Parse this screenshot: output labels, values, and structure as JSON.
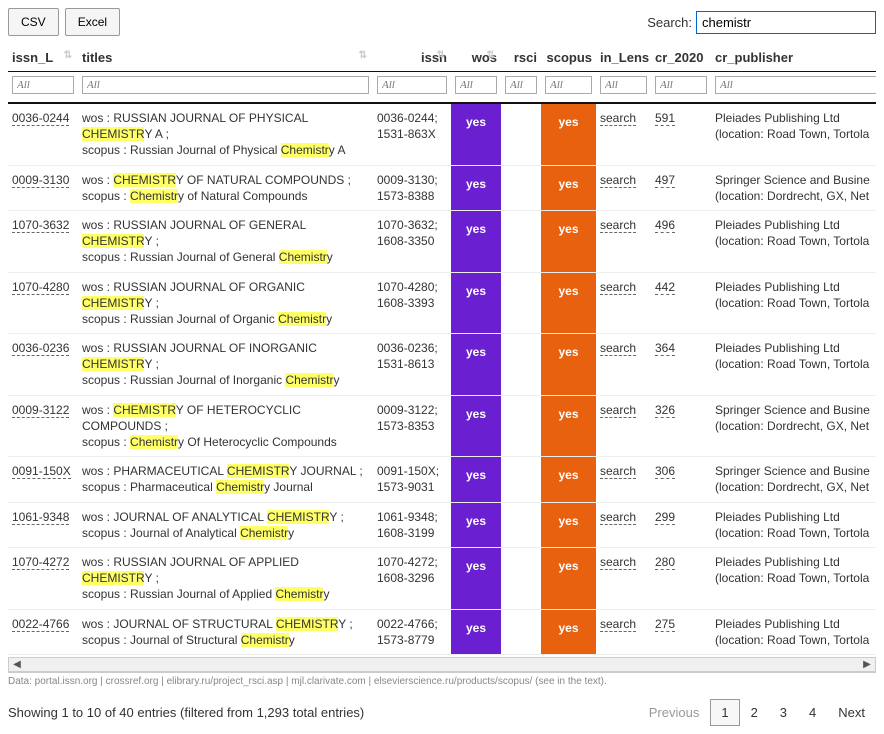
{
  "buttons": {
    "csv": "CSV",
    "excel": "Excel"
  },
  "search": {
    "label": "Search:",
    "value": "chemistr"
  },
  "headers": [
    "issn_L",
    "titles",
    "issn",
    "wos",
    "rsci",
    "scopus",
    "in_Lens",
    "cr_2020",
    "cr_publisher"
  ],
  "filter_ph": "All",
  "hlFull": "CHEMISTR",
  "hlLow": "Chemistr",
  "yes": "yes",
  "searchTxt": "search",
  "rows": [
    {
      "issn_l": "0036-0244",
      "t1a": "wos : RUSSIAN JOURNAL OF PHYSICAL ",
      "t1b": "Y A ;",
      "t2a": "scopus : Russian Journal of Physical ",
      "t2b": "y A",
      "issn": "0036-0244; 1531-863X",
      "cr": "591",
      "pub": "Pleiades Publishing Ltd",
      "loc": "(location: Road Town, Tortola"
    },
    {
      "issn_l": "0009-3130",
      "t1a": "wos : ",
      "t1b": "Y OF NATURAL COMPOUNDS ;",
      "t2a": "scopus : ",
      "t2b": "y of Natural Compounds",
      "issn": "0009-3130; 1573-8388",
      "cr": "497",
      "pub": "Springer Science and Busine",
      "loc": "(location: Dordrecht, GX, Net"
    },
    {
      "issn_l": "1070-3632",
      "t1a": "wos : RUSSIAN JOURNAL OF GENERAL ",
      "t1b": "Y ;",
      "t2a": "scopus : Russian Journal of General ",
      "t2b": "y",
      "issn": "1070-3632; 1608-3350",
      "cr": "496",
      "pub": "Pleiades Publishing Ltd",
      "loc": "(location: Road Town, Tortola"
    },
    {
      "issn_l": "1070-4280",
      "t1a": "wos : RUSSIAN JOURNAL OF ORGANIC ",
      "t1b": "Y ;",
      "t2a": "scopus : Russian Journal of Organic ",
      "t2b": "y",
      "issn": "1070-4280; 1608-3393",
      "cr": "442",
      "pub": "Pleiades Publishing Ltd",
      "loc": "(location: Road Town, Tortola"
    },
    {
      "issn_l": "0036-0236",
      "t1a": "wos : RUSSIAN JOURNAL OF INORGANIC ",
      "t1b": "Y ;",
      "t2a": "scopus : Russian Journal of Inorganic ",
      "t2b": "y",
      "issn": "0036-0236; 1531-8613",
      "cr": "364",
      "pub": "Pleiades Publishing Ltd",
      "loc": "(location: Road Town, Tortola"
    },
    {
      "issn_l": "0009-3122",
      "t1a": "wos : ",
      "t1b": "Y OF HETEROCYCLIC COMPOUNDS ;",
      "t2a": "scopus : ",
      "t2b": "y Of Heterocyclic Compounds",
      "issn": "0009-3122; 1573-8353",
      "cr": "326",
      "pub": "Springer Science and Busine",
      "loc": "(location: Dordrecht, GX, Net"
    },
    {
      "issn_l": "0091-150X",
      "t1a": "wos : PHARMACEUTICAL ",
      "t1b": "Y JOURNAL ;",
      "t2a": "scopus : Pharmaceutical ",
      "t2b": "y Journal",
      "issn": "0091-150X; 1573-9031",
      "cr": "306",
      "pub": "Springer Science and Busine",
      "loc": "(location: Dordrecht, GX, Net"
    },
    {
      "issn_l": "1061-9348",
      "t1a": "wos : JOURNAL OF ANALYTICAL ",
      "t1b": "Y ;",
      "t2a": "scopus : Journal of Analytical ",
      "t2b": "y",
      "issn": "1061-9348; 1608-3199",
      "cr": "299",
      "pub": "Pleiades Publishing Ltd",
      "loc": "(location: Road Town, Tortola"
    },
    {
      "issn_l": "1070-4272",
      "t1a": "wos : RUSSIAN JOURNAL OF APPLIED ",
      "t1b": "Y ;",
      "t2a": "scopus : Russian Journal of Applied ",
      "t2b": "y",
      "issn": "1070-4272; 1608-3296",
      "cr": "280",
      "pub": "Pleiades Publishing Ltd",
      "loc": "(location: Road Town, Tortola"
    },
    {
      "issn_l": "0022-4766",
      "t1a": "wos : JOURNAL OF STRUCTURAL ",
      "t1b": "Y ;",
      "t2a": "scopus : Journal of Structural ",
      "t2b": "y",
      "issn": "0022-4766; 1573-8779",
      "cr": "275",
      "pub": "Pleiades Publishing Ltd",
      "loc": "(location: Road Town, Tortola"
    }
  ],
  "footer_data": "Data: portal.issn.org | crossref.org | elibrary.ru/project_rsci.asp | mjl.clarivate.com | elsevierscience.ru/products/scopus/ (see in the text).",
  "pager": {
    "info": "Showing 1 to 10 of 40 entries (filtered from 1,293 total entries)",
    "prev": "Previous",
    "next": "Next",
    "pages": [
      "1",
      "2",
      "3",
      "4"
    ],
    "active": 0
  }
}
